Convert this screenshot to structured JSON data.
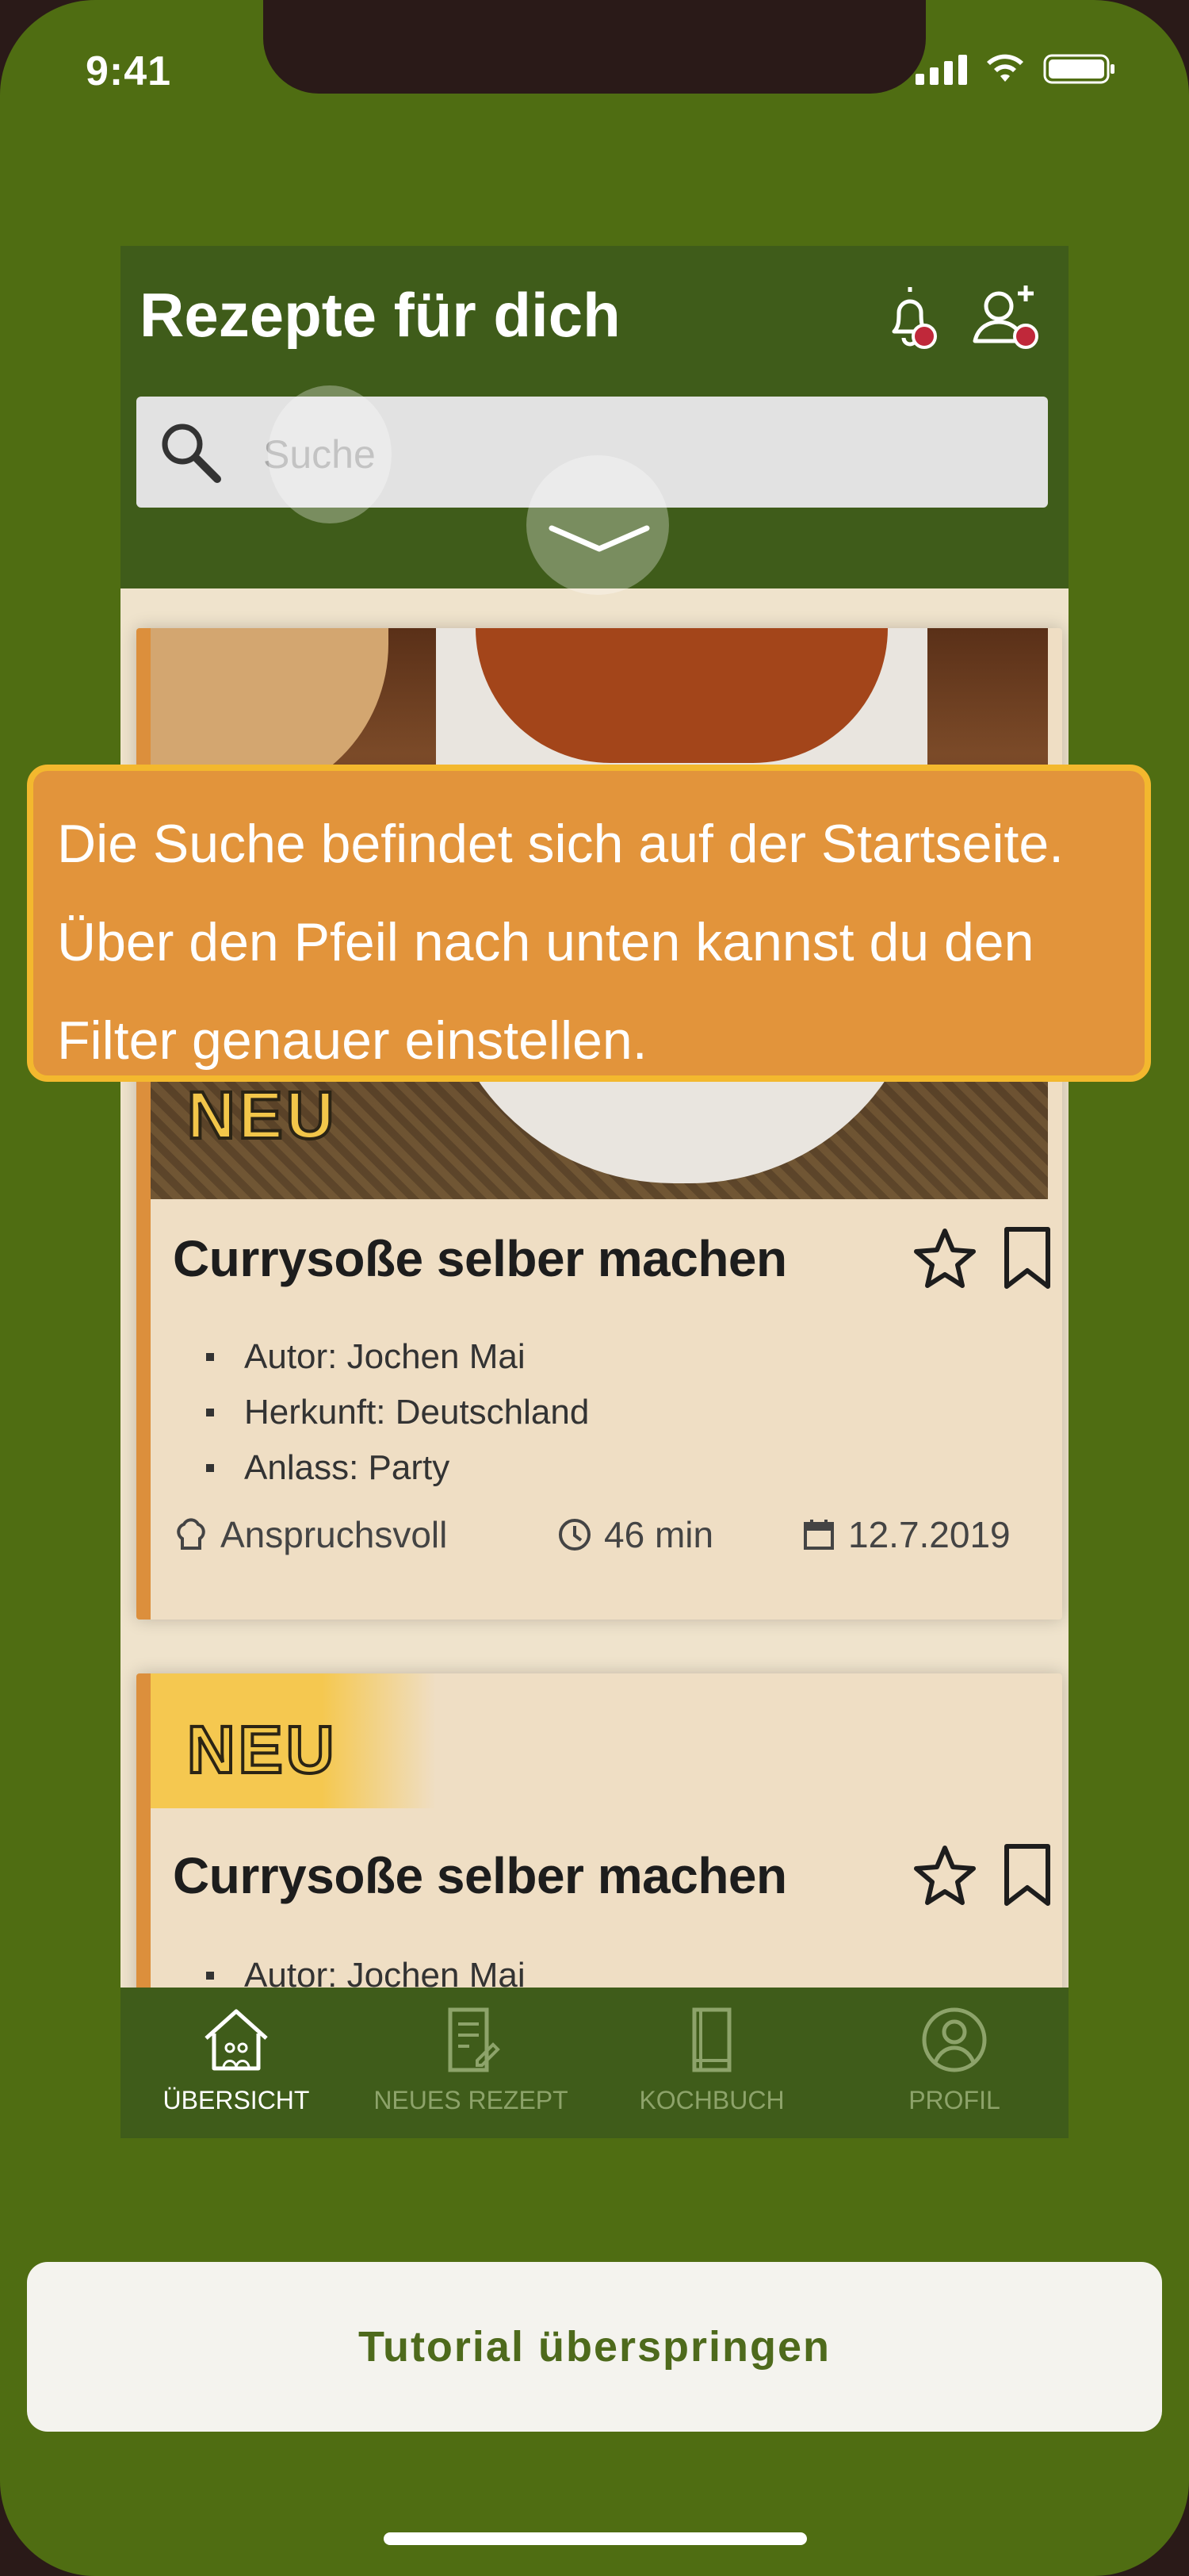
{
  "status_bar": {
    "time": "9:41"
  },
  "header": {
    "title": "Rezepte für dich",
    "bell_icon": "bell-icon",
    "add_user_icon": "add-user-icon"
  },
  "search": {
    "placeholder": "Suche",
    "icon": "search-icon"
  },
  "cards": [
    {
      "badge": "NEU",
      "title": "Currysoße selber machen",
      "details": [
        "Autor: Jochen Mai",
        "Herkunft: Deutschland",
        "Anlass: Party"
      ],
      "difficulty": "Anspruchsvoll",
      "duration": "46 min",
      "date": "12.7.2019"
    },
    {
      "badge": "NEU",
      "title": "Currysoße selber machen",
      "details": [
        "Autor: Jochen Mai"
      ]
    }
  ],
  "bottom_nav": [
    {
      "label": "ÜBERSICHT",
      "icon": "home-icon",
      "active": true
    },
    {
      "label": "NEUES REZEPT",
      "icon": "new-recipe-icon",
      "active": false
    },
    {
      "label": "KOCHBUCH",
      "icon": "cookbook-icon",
      "active": false
    },
    {
      "label": "PROFIL",
      "icon": "profile-icon",
      "active": false
    }
  ],
  "tooltip": {
    "text": "Die Suche befindet sich auf der Startseite. Über den Pfeil nach unten kannst du den Filter genauer einstellen."
  },
  "skip_button": {
    "label": "Tutorial überspringen"
  },
  "colors": {
    "background": "#4f6d12",
    "app_header": "#3f5c1a",
    "tooltip": "#e2943b",
    "tooltip_border": "#f3b82e",
    "card_accent": "#dc8f3c",
    "skip_text": "#4e6a1c"
  }
}
